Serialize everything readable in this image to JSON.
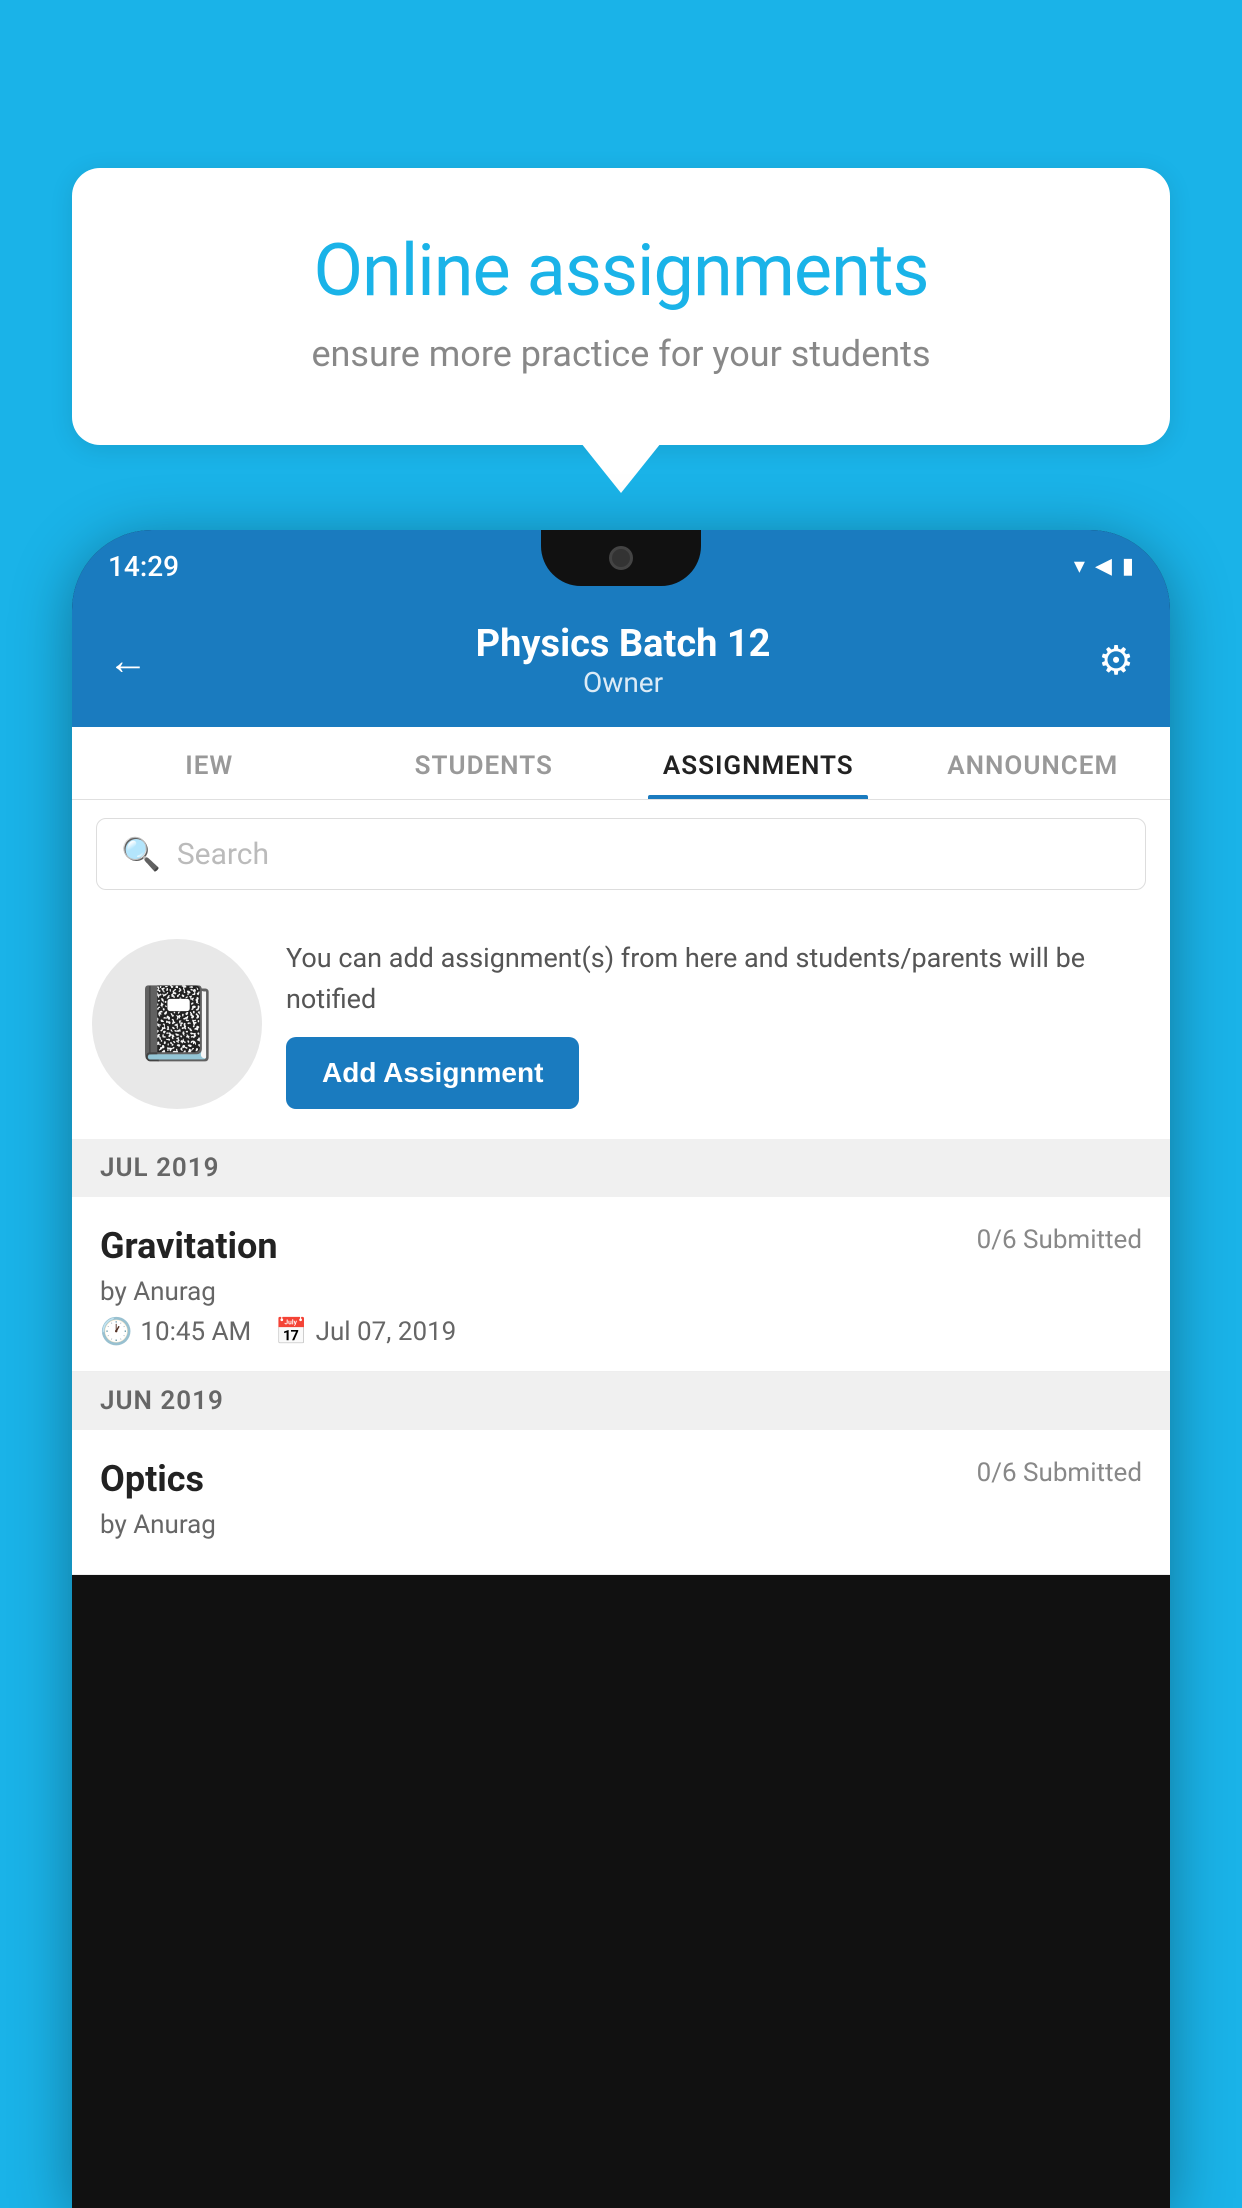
{
  "background_color": "#1ab3e8",
  "speech_bubble": {
    "title": "Online assignments",
    "subtitle": "ensure more practice for your students"
  },
  "phone": {
    "status_bar": {
      "time": "14:29",
      "icons": [
        "▾",
        "◀",
        "▮"
      ]
    },
    "header": {
      "title": "Physics Batch 12",
      "subtitle": "Owner",
      "back_label": "←",
      "settings_label": "⚙"
    },
    "tabs": [
      {
        "label": "IEW",
        "active": false
      },
      {
        "label": "STUDENTS",
        "active": false
      },
      {
        "label": "ASSIGNMENTS",
        "active": true
      },
      {
        "label": "ANNOUNCEM",
        "active": false
      }
    ],
    "search": {
      "placeholder": "Search",
      "icon": "🔍"
    },
    "promo": {
      "description": "You can add assignment(s) from here and students/parents will be notified",
      "button_label": "Add Assignment",
      "icon": "📓"
    },
    "sections": [
      {
        "month": "JUL 2019",
        "assignments": [
          {
            "name": "Gravitation",
            "submitted": "0/6 Submitted",
            "by": "by Anurag",
            "time": "10:45 AM",
            "date": "Jul 07, 2019"
          }
        ]
      },
      {
        "month": "JUN 2019",
        "assignments": [
          {
            "name": "Optics",
            "submitted": "0/6 Submitted",
            "by": "by Anurag",
            "time": "",
            "date": ""
          }
        ]
      }
    ]
  }
}
